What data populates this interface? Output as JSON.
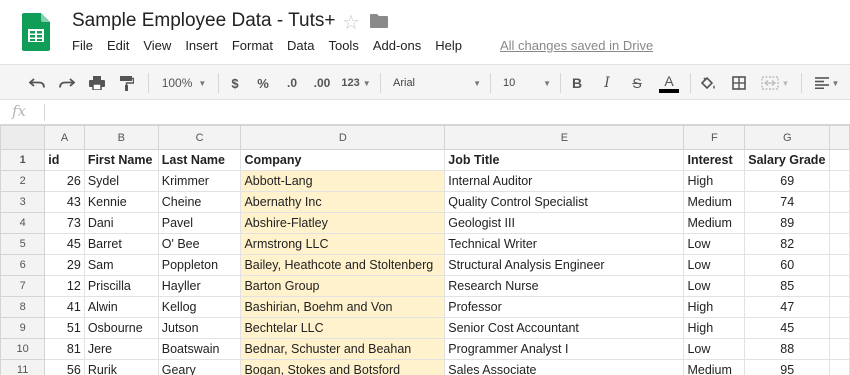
{
  "app": {
    "doc_title": "Sample Employee Data - Tuts+",
    "save_status": "All changes saved in Drive",
    "brand_color": "#0f9d58"
  },
  "menu": [
    "File",
    "Edit",
    "View",
    "Insert",
    "Format",
    "Data",
    "Tools",
    "Add-ons",
    "Help"
  ],
  "toolbar": {
    "zoom": "100%",
    "currency": "$",
    "percent": "%",
    "decrease_decimals": ".0",
    "increase_decimals": ".00",
    "more_formats": "123",
    "font": "Arial",
    "font_size": "10",
    "bold": "B",
    "italic": "I",
    "strikethrough": "S",
    "text_color": "A",
    "icons": [
      "undo-icon",
      "redo-icon",
      "print-icon",
      "paint-format-icon",
      "fill-color-icon",
      "borders-icon",
      "merge-cells-icon",
      "align-left-icon"
    ]
  },
  "formula_bar": {
    "label": "fx",
    "value": ""
  },
  "columns": [
    "A",
    "B",
    "C",
    "D",
    "E",
    "F",
    "G"
  ],
  "headers": [
    "id",
    "First Name",
    "Last Name",
    "Company",
    "Job Title",
    "Interest",
    "Salary Grade"
  ],
  "rows": [
    {
      "n": "1"
    },
    {
      "n": "2",
      "cells": [
        "26",
        "Sydel",
        "Krimmer",
        "Abbott-Lang",
        "Internal Auditor",
        "High",
        "69"
      ]
    },
    {
      "n": "3",
      "cells": [
        "43",
        "Kennie",
        "Cheine",
        "Abernathy Inc",
        "Quality Control Specialist",
        "Medium",
        "74"
      ]
    },
    {
      "n": "4",
      "cells": [
        "73",
        "Dani",
        "Pavel",
        "Abshire-Flatley",
        "Geologist III",
        "Medium",
        "89"
      ]
    },
    {
      "n": "5",
      "cells": [
        "45",
        "Barret",
        "O' Bee",
        "Armstrong LLC",
        "Technical Writer",
        "Low",
        "82"
      ]
    },
    {
      "n": "6",
      "cells": [
        "29",
        "Sam",
        "Poppleton",
        "Bailey, Heathcote and Stoltenberg",
        "Structural Analysis Engineer",
        "Low",
        "60"
      ]
    },
    {
      "n": "7",
      "cells": [
        "12",
        "Priscilla",
        "Hayller",
        "Barton Group",
        "Research Nurse",
        "Low",
        "85"
      ]
    },
    {
      "n": "8",
      "cells": [
        "41",
        "Alwin",
        "Kellog",
        "Bashirian, Boehm and Von",
        "Professor",
        "High",
        "47"
      ]
    },
    {
      "n": "9",
      "cells": [
        "51",
        "Osbourne",
        "Jutson",
        "Bechtelar LLC",
        "Senior Cost Accountant",
        "High",
        "45"
      ]
    },
    {
      "n": "10",
      "cells": [
        "81",
        "Jere",
        "Boatswain",
        "Bednar, Schuster and Beahan",
        "Programmer Analyst I",
        "Low",
        "88"
      ]
    },
    {
      "n": "11",
      "cells": [
        "56",
        "Rurik",
        "Geary",
        "Bogan, Stokes and Botsford",
        "Sales Associate",
        "Medium",
        "95"
      ]
    }
  ],
  "highlight_color": "#fff2cc"
}
